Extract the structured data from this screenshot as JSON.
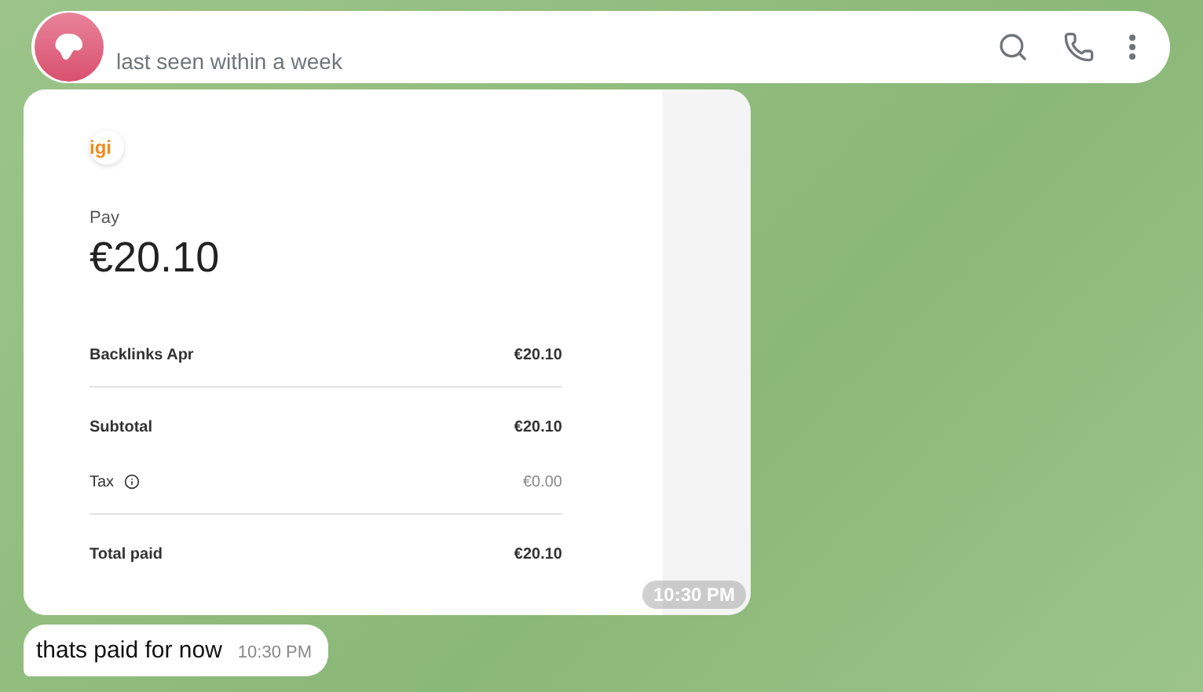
{
  "header": {
    "status": "last seen within a week"
  },
  "receipt": {
    "logo": "igi",
    "pay_label": "Pay",
    "amount": "€20.10",
    "items": [
      {
        "label": "Backlinks Apr",
        "value": "€20.10",
        "kind": "item"
      },
      {
        "label": "Subtotal",
        "value": "€20.10",
        "kind": "subtotal"
      },
      {
        "label": "Tax",
        "value": "€0.00",
        "kind": "tax"
      },
      {
        "label": "Total paid",
        "value": "€20.10",
        "kind": "total"
      }
    ],
    "time": "10:30 PM"
  },
  "message": {
    "text": "thats paid for now",
    "time": "10:30 PM"
  }
}
